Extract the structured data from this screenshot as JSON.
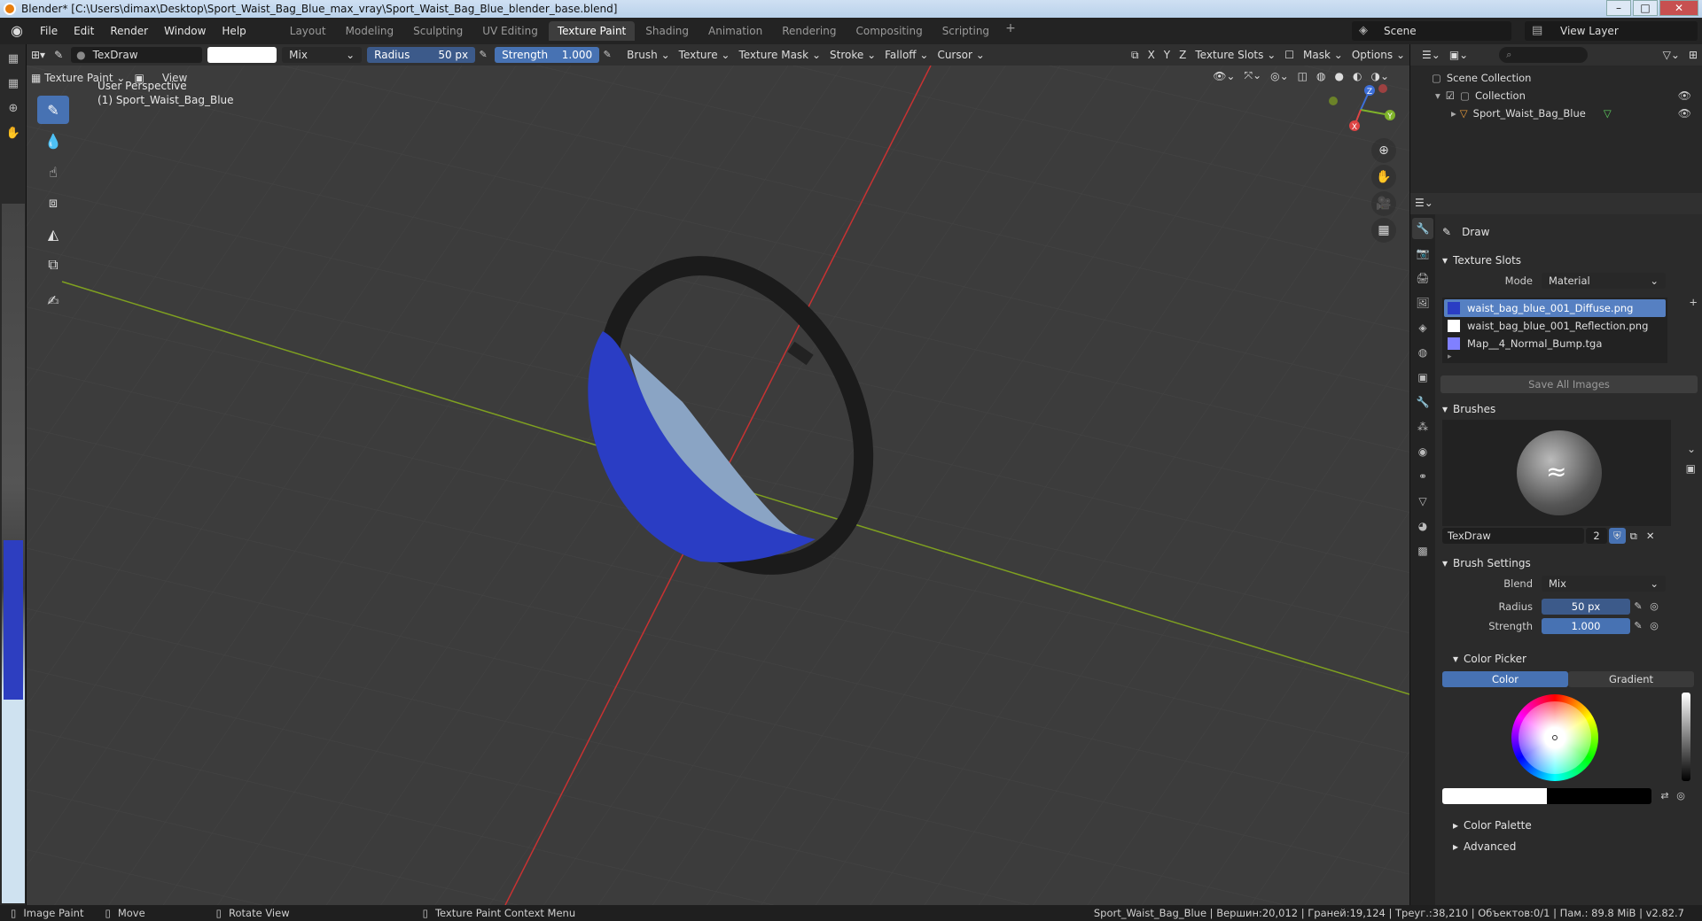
{
  "window": {
    "title": "Blender* [C:\\Users\\dimax\\Desktop\\Sport_Waist_Bag_Blue_max_vray\\Sport_Waist_Bag_Blue_blender_base.blend]",
    "btn_min": "–",
    "btn_max": "□",
    "btn_close": "✕"
  },
  "menubar": {
    "items": [
      "File",
      "Edit",
      "Render",
      "Window",
      "Help"
    ],
    "workspaces": [
      "Layout",
      "Modeling",
      "Sculpting",
      "UV Editing",
      "Texture Paint",
      "Shading",
      "Animation",
      "Rendering",
      "Compositing",
      "Scripting"
    ],
    "active_workspace": "Texture Paint",
    "add_tab": "+",
    "scene": "Scene",
    "view_layer": "View Layer"
  },
  "tool_header": {
    "brush_name": "TexDraw",
    "blend": "Mix",
    "radius_label": "Radius",
    "radius_value": "50 px",
    "strength_label": "Strength",
    "strength_value": "1.000",
    "menus": [
      "Brush",
      "Texture",
      "Texture Mask",
      "Stroke",
      "Falloff",
      "Cursor"
    ],
    "axes": [
      "X",
      "Y",
      "Z"
    ],
    "texture_slots": "Texture Slots",
    "mask": "Mask",
    "options": "Options"
  },
  "viewport": {
    "mode": "Texture Paint",
    "view_menu": "View",
    "perspective": "User Perspective",
    "object": "(1) Sport_Waist_Bag_Blue",
    "gizmo": {
      "x": "X",
      "y": "Y",
      "z": "Z"
    }
  },
  "outliner": {
    "scene_collection": "Scene Collection",
    "collection": "Collection",
    "object": "Sport_Waist_Bag_Blue"
  },
  "properties": {
    "tool": "Draw",
    "texture_slots": {
      "title": "Texture Slots",
      "mode_label": "Mode",
      "mode_value": "Material",
      "slots": [
        "waist_bag_blue_001_Diffuse.png",
        "waist_bag_blue_001_Reflection.png",
        "Map__4_Normal_Bump.tga"
      ],
      "save_all": "Save All Images"
    },
    "brushes": {
      "title": "Brushes",
      "brush_name": "TexDraw",
      "users": "2"
    },
    "brush_settings": {
      "title": "Brush Settings",
      "blend_label": "Blend",
      "blend_value": "Mix",
      "radius_label": "Radius",
      "radius_value": "50 px",
      "strength_label": "Strength",
      "strength_value": "1.000"
    },
    "color_picker": {
      "title": "Color Picker",
      "tab_color": "Color",
      "tab_gradient": "Gradient"
    },
    "color_palette": "Color Palette",
    "advanced": "Advanced"
  },
  "statusbar": {
    "image_paint": "Image Paint",
    "move": "Move",
    "rotate_view": "Rotate View",
    "context_menu": "Texture Paint Context Menu",
    "stats": "Sport_Waist_Bag_Blue | Вершин:20,012 | Граней:19,124 | Треуг.:38,210 | Объектов:0/1 | Пам.: 89.8 MiB | v2.82.7"
  },
  "colors": {
    "accent": "#4772b3",
    "bag_blue": "#2a3dc4",
    "strap": "#1c1c1c",
    "axis_x": "#c83232",
    "axis_y": "#7fa020"
  }
}
